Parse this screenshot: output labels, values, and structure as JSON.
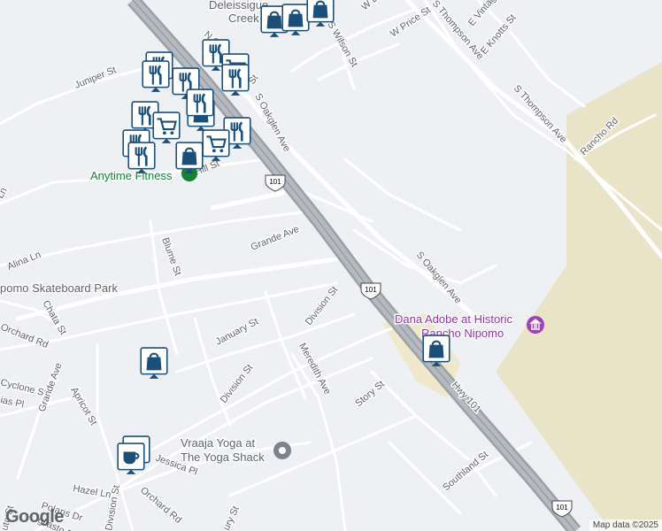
{
  "map": {
    "streets": {
      "juniper": "Juniper St",
      "hill": "Hill St",
      "grande_ave": "Grande Ave",
      "blume": "Blume St",
      "alina": "Alina Ln",
      "ln": "Ln",
      "chata": "Chata St",
      "orchard_rd": "Orchard Rd",
      "orchard_rd_south": "Orchard Rd",
      "cyclone": "Cyclone St",
      "grande_ave_west": "Grande Ave",
      "apricot": "Apricot St",
      "ias": "ias Pl",
      "hazel": "Hazel Ln",
      "polaris": "Polaris Dr",
      "gliasto": "gliasto Dr",
      "uto": "uto St",
      "division_north": "Division St",
      "division_south": "Division St",
      "division_vertical": "Division St",
      "january": "January St",
      "meredith": "Meredith Ave",
      "story": "Story St",
      "jessica": "Jessica Pl",
      "southland": "Southland St",
      "ury": "ury St",
      "s_oakglen_north": "S Oakglen Ave",
      "s_oakglen_south": "S Oakglen Ave",
      "s_wilson": "S Wilson St",
      "w_price": "W Price St",
      "w_da": "W Da",
      "e_vintage": "E Vintage St",
      "e_knotts": "E Knotts St",
      "s_thompson_north": "S Thompson Ave",
      "s_thompson_east": "S Thompson Ave",
      "rancho_rd": "Rancho Rd",
      "hwy101": "Hwy 101",
      "n_o": "N O",
      "st": "St"
    },
    "shields": [
      "101",
      "101",
      "101"
    ],
    "places": {
      "skatepark": "pomo Skateboard Park",
      "anytime": "Anytime Fitness",
      "deleissigues_1": "Deleissigue",
      "deleissigues_2": "Creek",
      "dana_1": "Dana Adobe at Historic",
      "dana_2": "Rancho Nipomo",
      "yoga_1": "Vraaja Yoga at",
      "yoga_2": "The Yoga Shack"
    },
    "markers": [
      {
        "type": "restaurant-icon"
      },
      {
        "type": "restaurant-icon"
      },
      {
        "type": "restaurant-icon"
      },
      {
        "type": "restaurant-icon"
      },
      {
        "type": "restaurant-icon"
      },
      {
        "type": "restaurant-icon"
      },
      {
        "type": "restaurant-icon"
      },
      {
        "type": "restaurant-icon"
      },
      {
        "type": "restaurant-icon"
      },
      {
        "type": "restaurant-icon"
      },
      {
        "type": "shopping-bag-icon"
      },
      {
        "type": "shopping-bag-icon"
      },
      {
        "type": "shopping-bag-icon"
      },
      {
        "type": "shopping-bag-icon"
      },
      {
        "type": "shopping-bag-icon"
      },
      {
        "type": "shopping-bag-icon"
      },
      {
        "type": "shopping-bag-icon"
      },
      {
        "type": "shopping-cart-icon"
      },
      {
        "type": "shopping-cart-icon"
      },
      {
        "type": "coffee-cup-icon"
      },
      {
        "type": "coffee-cup-icon"
      }
    ],
    "colors": {
      "land": "#eef0f3",
      "road": "#ffffff",
      "highway": "#9aa0a6",
      "park": "#e8e2c7",
      "marker": "#1a4f7a"
    }
  },
  "footer": {
    "logo": "Google",
    "attribution": "Map data ©2025"
  }
}
